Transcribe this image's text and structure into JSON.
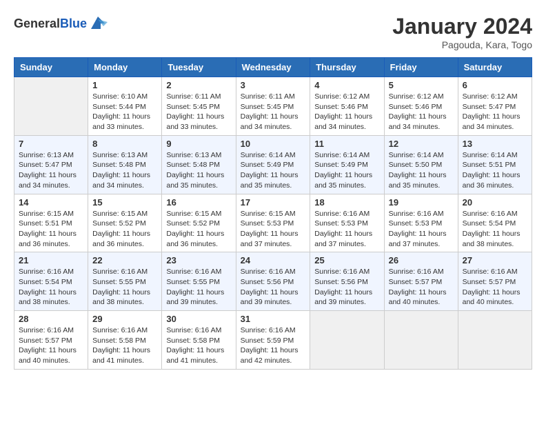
{
  "header": {
    "logo_general": "General",
    "logo_blue": "Blue",
    "month_title": "January 2024",
    "location": "Pagouda, Kara, Togo"
  },
  "days_of_week": [
    "Sunday",
    "Monday",
    "Tuesday",
    "Wednesday",
    "Thursday",
    "Friday",
    "Saturday"
  ],
  "weeks": [
    [
      {
        "day": "",
        "sunrise": "",
        "sunset": "",
        "daylight": ""
      },
      {
        "day": "1",
        "sunrise": "Sunrise: 6:10 AM",
        "sunset": "Sunset: 5:44 PM",
        "daylight": "Daylight: 11 hours and 33 minutes."
      },
      {
        "day": "2",
        "sunrise": "Sunrise: 6:11 AM",
        "sunset": "Sunset: 5:45 PM",
        "daylight": "Daylight: 11 hours and 33 minutes."
      },
      {
        "day": "3",
        "sunrise": "Sunrise: 6:11 AM",
        "sunset": "Sunset: 5:45 PM",
        "daylight": "Daylight: 11 hours and 34 minutes."
      },
      {
        "day": "4",
        "sunrise": "Sunrise: 6:12 AM",
        "sunset": "Sunset: 5:46 PM",
        "daylight": "Daylight: 11 hours and 34 minutes."
      },
      {
        "day": "5",
        "sunrise": "Sunrise: 6:12 AM",
        "sunset": "Sunset: 5:46 PM",
        "daylight": "Daylight: 11 hours and 34 minutes."
      },
      {
        "day": "6",
        "sunrise": "Sunrise: 6:12 AM",
        "sunset": "Sunset: 5:47 PM",
        "daylight": "Daylight: 11 hours and 34 minutes."
      }
    ],
    [
      {
        "day": "7",
        "sunrise": "Sunrise: 6:13 AM",
        "sunset": "Sunset: 5:47 PM",
        "daylight": "Daylight: 11 hours and 34 minutes."
      },
      {
        "day": "8",
        "sunrise": "Sunrise: 6:13 AM",
        "sunset": "Sunset: 5:48 PM",
        "daylight": "Daylight: 11 hours and 34 minutes."
      },
      {
        "day": "9",
        "sunrise": "Sunrise: 6:13 AM",
        "sunset": "Sunset: 5:48 PM",
        "daylight": "Daylight: 11 hours and 35 minutes."
      },
      {
        "day": "10",
        "sunrise": "Sunrise: 6:14 AM",
        "sunset": "Sunset: 5:49 PM",
        "daylight": "Daylight: 11 hours and 35 minutes."
      },
      {
        "day": "11",
        "sunrise": "Sunrise: 6:14 AM",
        "sunset": "Sunset: 5:49 PM",
        "daylight": "Daylight: 11 hours and 35 minutes."
      },
      {
        "day": "12",
        "sunrise": "Sunrise: 6:14 AM",
        "sunset": "Sunset: 5:50 PM",
        "daylight": "Daylight: 11 hours and 35 minutes."
      },
      {
        "day": "13",
        "sunrise": "Sunrise: 6:14 AM",
        "sunset": "Sunset: 5:51 PM",
        "daylight": "Daylight: 11 hours and 36 minutes."
      }
    ],
    [
      {
        "day": "14",
        "sunrise": "Sunrise: 6:15 AM",
        "sunset": "Sunset: 5:51 PM",
        "daylight": "Daylight: 11 hours and 36 minutes."
      },
      {
        "day": "15",
        "sunrise": "Sunrise: 6:15 AM",
        "sunset": "Sunset: 5:52 PM",
        "daylight": "Daylight: 11 hours and 36 minutes."
      },
      {
        "day": "16",
        "sunrise": "Sunrise: 6:15 AM",
        "sunset": "Sunset: 5:52 PM",
        "daylight": "Daylight: 11 hours and 36 minutes."
      },
      {
        "day": "17",
        "sunrise": "Sunrise: 6:15 AM",
        "sunset": "Sunset: 5:53 PM",
        "daylight": "Daylight: 11 hours and 37 minutes."
      },
      {
        "day": "18",
        "sunrise": "Sunrise: 6:16 AM",
        "sunset": "Sunset: 5:53 PM",
        "daylight": "Daylight: 11 hours and 37 minutes."
      },
      {
        "day": "19",
        "sunrise": "Sunrise: 6:16 AM",
        "sunset": "Sunset: 5:53 PM",
        "daylight": "Daylight: 11 hours and 37 minutes."
      },
      {
        "day": "20",
        "sunrise": "Sunrise: 6:16 AM",
        "sunset": "Sunset: 5:54 PM",
        "daylight": "Daylight: 11 hours and 38 minutes."
      }
    ],
    [
      {
        "day": "21",
        "sunrise": "Sunrise: 6:16 AM",
        "sunset": "Sunset: 5:54 PM",
        "daylight": "Daylight: 11 hours and 38 minutes."
      },
      {
        "day": "22",
        "sunrise": "Sunrise: 6:16 AM",
        "sunset": "Sunset: 5:55 PM",
        "daylight": "Daylight: 11 hours and 38 minutes."
      },
      {
        "day": "23",
        "sunrise": "Sunrise: 6:16 AM",
        "sunset": "Sunset: 5:55 PM",
        "daylight": "Daylight: 11 hours and 39 minutes."
      },
      {
        "day": "24",
        "sunrise": "Sunrise: 6:16 AM",
        "sunset": "Sunset: 5:56 PM",
        "daylight": "Daylight: 11 hours and 39 minutes."
      },
      {
        "day": "25",
        "sunrise": "Sunrise: 6:16 AM",
        "sunset": "Sunset: 5:56 PM",
        "daylight": "Daylight: 11 hours and 39 minutes."
      },
      {
        "day": "26",
        "sunrise": "Sunrise: 6:16 AM",
        "sunset": "Sunset: 5:57 PM",
        "daylight": "Daylight: 11 hours and 40 minutes."
      },
      {
        "day": "27",
        "sunrise": "Sunrise: 6:16 AM",
        "sunset": "Sunset: 5:57 PM",
        "daylight": "Daylight: 11 hours and 40 minutes."
      }
    ],
    [
      {
        "day": "28",
        "sunrise": "Sunrise: 6:16 AM",
        "sunset": "Sunset: 5:57 PM",
        "daylight": "Daylight: 11 hours and 40 minutes."
      },
      {
        "day": "29",
        "sunrise": "Sunrise: 6:16 AM",
        "sunset": "Sunset: 5:58 PM",
        "daylight": "Daylight: 11 hours and 41 minutes."
      },
      {
        "day": "30",
        "sunrise": "Sunrise: 6:16 AM",
        "sunset": "Sunset: 5:58 PM",
        "daylight": "Daylight: 11 hours and 41 minutes."
      },
      {
        "day": "31",
        "sunrise": "Sunrise: 6:16 AM",
        "sunset": "Sunset: 5:59 PM",
        "daylight": "Daylight: 11 hours and 42 minutes."
      },
      {
        "day": "",
        "sunrise": "",
        "sunset": "",
        "daylight": ""
      },
      {
        "day": "",
        "sunrise": "",
        "sunset": "",
        "daylight": ""
      },
      {
        "day": "",
        "sunrise": "",
        "sunset": "",
        "daylight": ""
      }
    ]
  ]
}
